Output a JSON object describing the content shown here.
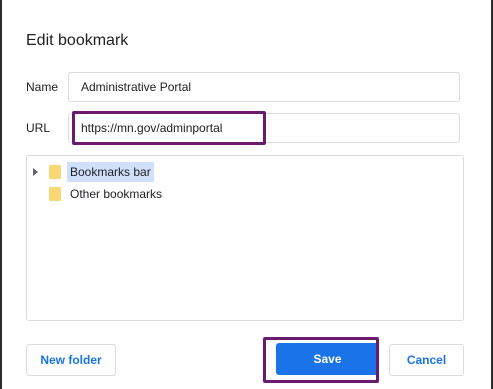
{
  "dialog": {
    "title": "Edit bookmark"
  },
  "fields": {
    "name_label": "Name",
    "name_value": "Administrative Portal",
    "url_label": "URL",
    "url_value": "https://mn.gov/adminportal"
  },
  "tree": {
    "items": [
      {
        "label": "Bookmarks bar",
        "icon": "folder-icon",
        "expandable": true,
        "selected": true
      },
      {
        "label": "Other bookmarks",
        "icon": "folder-icon",
        "expandable": false,
        "selected": false
      }
    ]
  },
  "buttons": {
    "new_folder": "New folder",
    "save": "Save",
    "cancel": "Cancel"
  },
  "colors": {
    "accent": "#1a73e8",
    "highlight": "#6a1b6e",
    "folder": "#f8d775",
    "selection": "#cfe0fb"
  }
}
